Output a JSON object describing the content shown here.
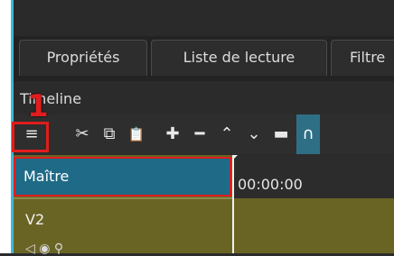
{
  "tabs": [
    {
      "label": "Propriétés"
    },
    {
      "label": "Liste de lecture"
    },
    {
      "label": "Filtre"
    }
  ],
  "timeline": {
    "title": "Timeline",
    "badge": "1",
    "toolbar": {
      "menu": "≡",
      "cut": "✂",
      "copy": "⧉",
      "paste": "📋",
      "add": "✚",
      "remove": "━",
      "lift": "⌃",
      "overwrite": "⌄",
      "split": "▬",
      "snap": "∩"
    },
    "timecode": "00:00:00",
    "tracks": [
      {
        "label": "Maître"
      },
      {
        "label": "V2"
      }
    ],
    "track_icons": "◁  ◉  ⚲"
  }
}
